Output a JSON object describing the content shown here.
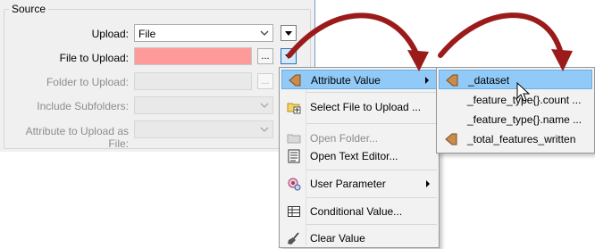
{
  "source_group": {
    "title": "Source",
    "rows": [
      {
        "label": "Upload:",
        "value": "File"
      },
      {
        "label": "File to Upload:",
        "value": ""
      },
      {
        "label": "Folder to Upload:",
        "value": ""
      },
      {
        "label": "Include Subfolders:",
        "value": ""
      },
      {
        "label": "Attribute to Upload as File:",
        "value": ""
      }
    ],
    "ellipsis": "..."
  },
  "context_menu": {
    "items": [
      {
        "label": "Attribute Value",
        "icon": "attribute-diamond-icon",
        "submenu": true
      },
      {
        "label": "Select File to Upload ...",
        "icon": "folder-select-icon"
      },
      {
        "label": "Open Folder...",
        "icon": "folder-icon",
        "disabled": true
      },
      {
        "label": "Open Text Editor...",
        "icon": "text-editor-icon"
      },
      {
        "label": "User Parameter",
        "icon": "user-parameter-icon",
        "submenu": true
      },
      {
        "label": "Conditional Value...",
        "icon": "table-icon"
      },
      {
        "label": "Clear Value",
        "icon": "broom-icon"
      }
    ]
  },
  "submenu": {
    "items": [
      {
        "label": "_dataset",
        "icon": "attribute-diamond-icon"
      },
      {
        "label": "_feature_type{}.count ...",
        "icon": ""
      },
      {
        "label": "_feature_type{}.name ...",
        "icon": ""
      },
      {
        "label": "_total_features_written",
        "icon": "attribute-diamond-icon"
      }
    ]
  },
  "colors": {
    "error_field": "#ff9a9a",
    "highlight": "#91c9f7",
    "arrow": "#9b1b1b",
    "diamond": "#c0894a"
  }
}
